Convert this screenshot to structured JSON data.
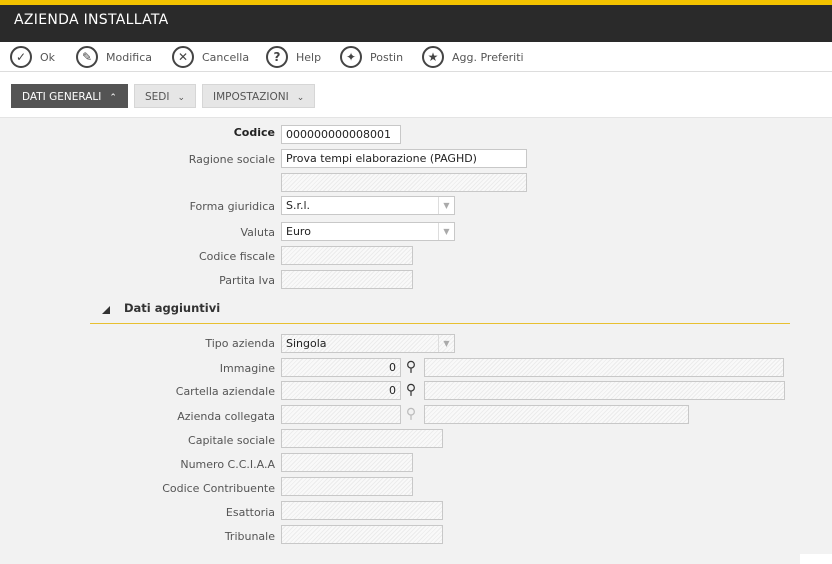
{
  "window": {
    "title": "AZIENDA INSTALLATA"
  },
  "toolbar": [
    {
      "id": "ok",
      "label": "Ok",
      "icon": "check-icon"
    },
    {
      "id": "modifica",
      "label": "Modifica",
      "icon": "pencil-icon"
    },
    {
      "id": "cancella",
      "label": "Cancella",
      "icon": "close-icon"
    },
    {
      "id": "help",
      "label": "Help",
      "icon": "help-icon"
    },
    {
      "id": "postin",
      "label": "Postin",
      "icon": "pin-icon"
    },
    {
      "id": "preferiti",
      "label": "Agg. Preferiti",
      "icon": "star-icon"
    }
  ],
  "tabs": [
    {
      "label": "DATI GENERALI",
      "active": true,
      "chevron": "up"
    },
    {
      "label": "SEDI",
      "active": false,
      "chevron": "down"
    },
    {
      "label": "IMPOSTAZIONI",
      "active": false,
      "chevron": "down"
    }
  ],
  "form": {
    "codice": {
      "label": "Codice",
      "value": "000000000008001"
    },
    "ragione_sociale": {
      "label": "Ragione sociale",
      "value": "Prova tempi elaborazione (PAGHD)",
      "value2": ""
    },
    "forma_giuridica": {
      "label": "Forma giuridica",
      "value": "S.r.l."
    },
    "valuta": {
      "label": "Valuta",
      "value": "Euro"
    },
    "codice_fiscale": {
      "label": "Codice fiscale",
      "value": ""
    },
    "partita_iva": {
      "label": "Partita Iva",
      "value": ""
    }
  },
  "section": {
    "title": "Dati aggiuntivi"
  },
  "extra": {
    "tipo_azienda": {
      "label": "Tipo azienda",
      "value": "Singola"
    },
    "immagine": {
      "label": "Immagine",
      "value": "0",
      "desc": ""
    },
    "cartella_aziendale": {
      "label": "Cartella aziendale",
      "value": "0",
      "desc": ""
    },
    "azienda_collegata": {
      "label": "Azienda collegata",
      "value": "",
      "desc": ""
    },
    "capitale_sociale": {
      "label": "Capitale sociale",
      "value": ""
    },
    "numero_cciaa": {
      "label": "Numero C.C.I.A.A",
      "value": ""
    },
    "codice_contribuente": {
      "label": "Codice Contribuente",
      "value": ""
    },
    "esattoria": {
      "label": "Esattoria",
      "value": ""
    },
    "tribunale": {
      "label": "Tribunale",
      "value": ""
    }
  },
  "colors": {
    "accent": "#f2c200",
    "titlebar": "#2a2a2a",
    "active_tab": "#545454"
  }
}
